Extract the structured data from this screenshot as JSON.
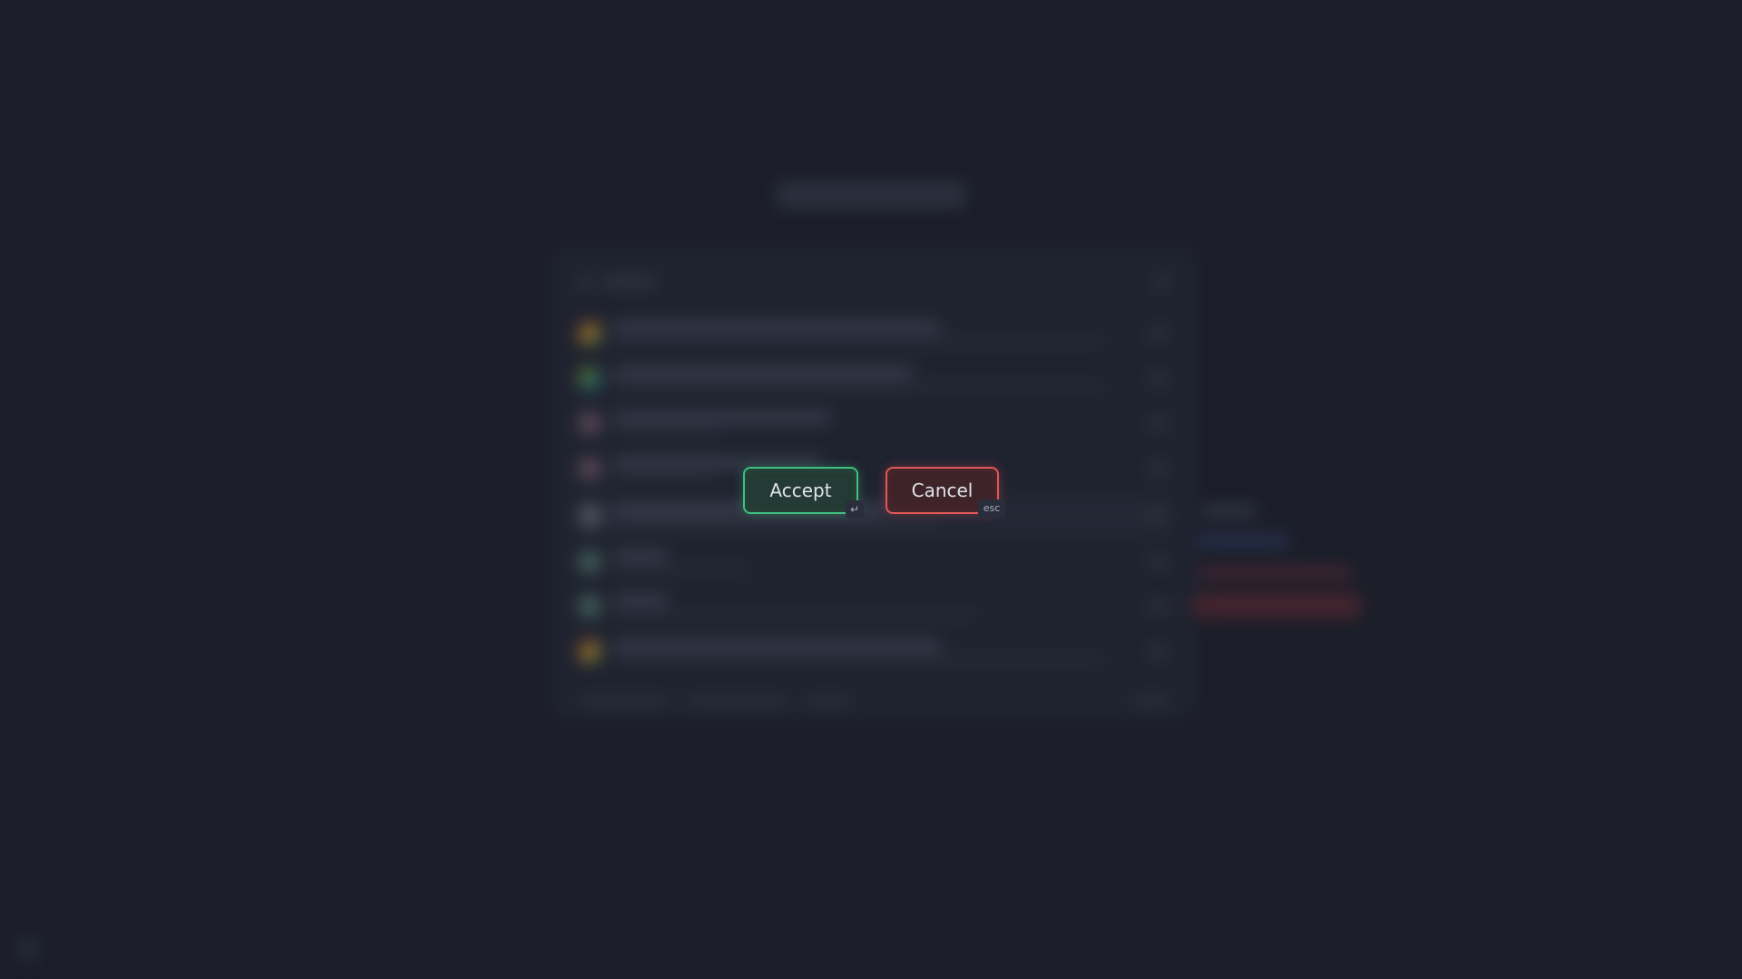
{
  "dialog": {
    "accept_label": "Accept",
    "accept_shortcut": "↵",
    "cancel_label": "Cancel",
    "cancel_shortcut": "esc"
  },
  "colors": {
    "background": "#1b1e29",
    "accept_accent": "#3fbf7f",
    "cancel_accent": "#e05757"
  },
  "icons": {
    "enter_key": "enter-key-icon"
  }
}
